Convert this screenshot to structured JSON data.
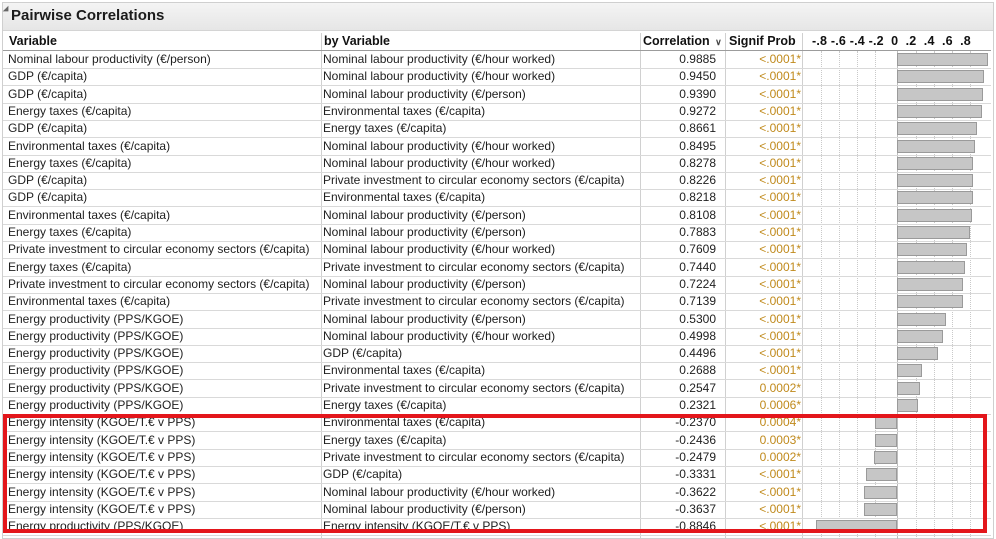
{
  "title": "Pairwise Correlations",
  "headers": {
    "variable": "Variable",
    "by_variable": "by Variable",
    "correlation": "Correlation",
    "signif_prob": "Signif Prob",
    "axis_ticks": "-.8 -.6 -.4 -.2  0  .2  .4  .6  .8"
  },
  "sort_icon": "chevron-down-icon",
  "colors": {
    "signif_text": "#c08a1c",
    "bar_fill": "#c6c6c6",
    "highlight_border": "#e3161b"
  },
  "rows": [
    {
      "variable": "Nominal labour productivity (€/person)",
      "by": "Nominal labour productivity (€/hour worked)",
      "corr": "0.9885",
      "sig": "<.0001*"
    },
    {
      "variable": "GDP (€/capita)",
      "by": "Nominal labour productivity (€/hour worked)",
      "corr": "0.9450",
      "sig": "<.0001*"
    },
    {
      "variable": "GDP (€/capita)",
      "by": "Nominal labour productivity (€/person)",
      "corr": "0.9390",
      "sig": "<.0001*"
    },
    {
      "variable": "Energy taxes (€/capita)",
      "by": "Environmental taxes (€/capita)",
      "corr": "0.9272",
      "sig": "<.0001*"
    },
    {
      "variable": "GDP (€/capita)",
      "by": "Energy taxes (€/capita)",
      "corr": "0.8661",
      "sig": "<.0001*"
    },
    {
      "variable": "Environmental taxes (€/capita)",
      "by": "Nominal labour productivity (€/hour worked)",
      "corr": "0.8495",
      "sig": "<.0001*"
    },
    {
      "variable": "Energy taxes (€/capita)",
      "by": "Nominal labour productivity (€/hour worked)",
      "corr": "0.8278",
      "sig": "<.0001*"
    },
    {
      "variable": "GDP (€/capita)",
      "by": "Private investment to circular economy sectors  (€/capita)",
      "corr": "0.8226",
      "sig": "<.0001*"
    },
    {
      "variable": "GDP (€/capita)",
      "by": "Environmental taxes (€/capita)",
      "corr": "0.8218",
      "sig": "<.0001*"
    },
    {
      "variable": "Environmental taxes (€/capita)",
      "by": "Nominal labour productivity (€/person)",
      "corr": "0.8108",
      "sig": "<.0001*"
    },
    {
      "variable": "Energy taxes (€/capita)",
      "by": "Nominal labour productivity (€/person)",
      "corr": "0.7883",
      "sig": "<.0001*"
    },
    {
      "variable": "Private investment to circular economy sectors  (€/capita)",
      "by": "Nominal labour productivity (€/hour worked)",
      "corr": "0.7609",
      "sig": "<.0001*"
    },
    {
      "variable": "Energy taxes (€/capita)",
      "by": "Private investment to circular economy sectors  (€/capita)",
      "corr": "0.7440",
      "sig": "<.0001*"
    },
    {
      "variable": "Private investment to circular economy sectors  (€/capita)",
      "by": "Nominal labour productivity (€/person)",
      "corr": "0.7224",
      "sig": "<.0001*"
    },
    {
      "variable": "Environmental taxes (€/capita)",
      "by": "Private investment to circular economy sectors  (€/capita)",
      "corr": "0.7139",
      "sig": "<.0001*"
    },
    {
      "variable": "Energy productivity (PPS/KGOE)",
      "by": "Nominal labour productivity (€/person)",
      "corr": "0.5300",
      "sig": "<.0001*"
    },
    {
      "variable": "Energy productivity (PPS/KGOE)",
      "by": "Nominal labour productivity (€/hour worked)",
      "corr": "0.4998",
      "sig": "<.0001*"
    },
    {
      "variable": "Energy productivity (PPS/KGOE)",
      "by": "GDP (€/capita)",
      "corr": "0.4496",
      "sig": "<.0001*"
    },
    {
      "variable": "Energy productivity (PPS/KGOE)",
      "by": "Environmental taxes (€/capita)",
      "corr": "0.2688",
      "sig": "<.0001*"
    },
    {
      "variable": "Energy productivity (PPS/KGOE)",
      "by": "Private investment to circular economy sectors  (€/capita)",
      "corr": "0.2547",
      "sig": "0.0002*"
    },
    {
      "variable": "Energy productivity (PPS/KGOE)",
      "by": "Energy taxes (€/capita)",
      "corr": "0.2321",
      "sig": "0.0006*"
    },
    {
      "variable": "Energy intensity (KGOE/T.€ v PPS)",
      "by": "Environmental taxes (€/capita)",
      "corr": "-0.2370",
      "sig": "0.0004*"
    },
    {
      "variable": "Energy intensity (KGOE/T.€ v PPS)",
      "by": "Energy taxes (€/capita)",
      "corr": "-0.2436",
      "sig": "0.0003*"
    },
    {
      "variable": "Energy intensity (KGOE/T.€ v PPS)",
      "by": "Private investment to circular economy sectors  (€/capita)",
      "corr": "-0.2479",
      "sig": "0.0002*"
    },
    {
      "variable": "Energy intensity (KGOE/T.€ v PPS)",
      "by": "GDP (€/capita)",
      "corr": "-0.3331",
      "sig": "<.0001*"
    },
    {
      "variable": "Energy intensity (KGOE/T.€ v PPS)",
      "by": "Nominal labour productivity (€/hour worked)",
      "corr": "-0.3622",
      "sig": "<.0001*"
    },
    {
      "variable": "Energy intensity (KGOE/T.€ v PPS)",
      "by": "Nominal labour productivity (€/person)",
      "corr": "-0.3637",
      "sig": "<.0001*"
    },
    {
      "variable": "Energy productivity (PPS/KGOE)",
      "by": "Energy intensity (KGOE/T.€ v PPS)",
      "corr": "-0.8846",
      "sig": "<.0001*"
    }
  ]
}
